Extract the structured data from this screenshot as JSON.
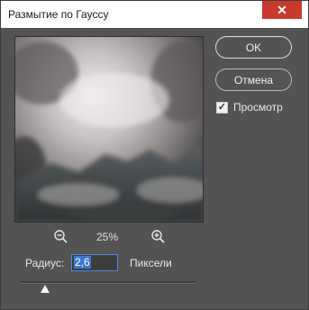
{
  "dialog": {
    "title": "Размытие по Гауссу",
    "close_glyph": "✕"
  },
  "buttons": {
    "ok_label": "OK",
    "cancel_label": "Отмена"
  },
  "preview": {
    "label": "Просмотр",
    "checked": true,
    "check_glyph": "✓",
    "image_description_icon": "cloudy-mountain-image"
  },
  "zoom": {
    "value": "25%",
    "out_icon": "zoom-out-icon",
    "in_icon": "zoom-in-icon"
  },
  "radius": {
    "label": "Радиус:",
    "value": "2,6",
    "units": "Пиксели",
    "slider_fraction": 0.14
  },
  "colors": {
    "background": "#535353",
    "close_button": "#c83a2c",
    "input_focus": "#4a8dd9",
    "selection": "#3b78d1"
  }
}
